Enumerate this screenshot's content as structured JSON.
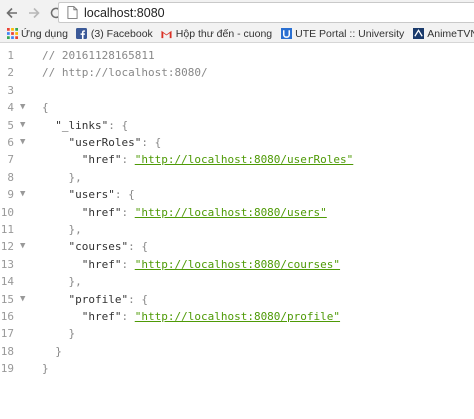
{
  "toolbar": {
    "url": "localhost:8080"
  },
  "bookmarks": [
    {
      "label": "Ứng dụng",
      "icon": "apps-grid-icon",
      "color": "#e94235"
    },
    {
      "label": "(3) Facebook",
      "icon": "facebook-icon",
      "color": "#3b5998"
    },
    {
      "label": "Hộp thư đến - cuong",
      "icon": "gmail-icon",
      "color": "#d93025"
    },
    {
      "label": "UTE Portal :: University",
      "icon": "ute-portal-icon",
      "color": "#2a6fd1"
    },
    {
      "label": "AnimeTVN - Anime V",
      "icon": "animetvn-icon",
      "color": "#1a3a6b"
    }
  ],
  "code": {
    "lines": [
      {
        "n": "1",
        "fold": "",
        "parts": [
          {
            "t": "// 20161128165811",
            "c": "comment"
          }
        ]
      },
      {
        "n": "2",
        "fold": "",
        "parts": [
          {
            "t": "// http://localhost:8080/",
            "c": "comment"
          }
        ]
      },
      {
        "n": "3",
        "fold": "",
        "parts": []
      },
      {
        "n": "4",
        "fold": "▼",
        "parts": [
          {
            "t": "{",
            "c": "punct"
          }
        ]
      },
      {
        "n": "5",
        "fold": "▼",
        "parts": [
          {
            "t": "  \"_links\"",
            "c": "key"
          },
          {
            "t": ": {",
            "c": "punct"
          }
        ]
      },
      {
        "n": "6",
        "fold": "▼",
        "parts": [
          {
            "t": "    \"userRoles\"",
            "c": "key"
          },
          {
            "t": ": {",
            "c": "punct"
          }
        ]
      },
      {
        "n": "7",
        "fold": "",
        "parts": [
          {
            "t": "      \"href\"",
            "c": "key"
          },
          {
            "t": ": ",
            "c": "punct"
          },
          {
            "t": "\"http://localhost:8080/userRoles\"",
            "c": "url"
          }
        ]
      },
      {
        "n": "8",
        "fold": "",
        "parts": [
          {
            "t": "    },",
            "c": "punct"
          }
        ]
      },
      {
        "n": "9",
        "fold": "▼",
        "parts": [
          {
            "t": "    \"users\"",
            "c": "key"
          },
          {
            "t": ": {",
            "c": "punct"
          }
        ]
      },
      {
        "n": "10",
        "fold": "",
        "parts": [
          {
            "t": "      \"href\"",
            "c": "key"
          },
          {
            "t": ": ",
            "c": "punct"
          },
          {
            "t": "\"http://localhost:8080/users\"",
            "c": "url"
          }
        ]
      },
      {
        "n": "11",
        "fold": "",
        "parts": [
          {
            "t": "    },",
            "c": "punct"
          }
        ]
      },
      {
        "n": "12",
        "fold": "▼",
        "parts": [
          {
            "t": "    \"courses\"",
            "c": "key"
          },
          {
            "t": ": {",
            "c": "punct"
          }
        ]
      },
      {
        "n": "13",
        "fold": "",
        "parts": [
          {
            "t": "      \"href\"",
            "c": "key"
          },
          {
            "t": ": ",
            "c": "punct"
          },
          {
            "t": "\"http://localhost:8080/courses\"",
            "c": "url"
          }
        ]
      },
      {
        "n": "14",
        "fold": "",
        "parts": [
          {
            "t": "    },",
            "c": "punct"
          }
        ]
      },
      {
        "n": "15",
        "fold": "▼",
        "parts": [
          {
            "t": "    \"profile\"",
            "c": "key"
          },
          {
            "t": ": {",
            "c": "punct"
          }
        ]
      },
      {
        "n": "16",
        "fold": "",
        "parts": [
          {
            "t": "      \"href\"",
            "c": "key"
          },
          {
            "t": ": ",
            "c": "punct"
          },
          {
            "t": "\"http://localhost:8080/profile\"",
            "c": "url"
          }
        ]
      },
      {
        "n": "17",
        "fold": "",
        "parts": [
          {
            "t": "    }",
            "c": "punct"
          }
        ]
      },
      {
        "n": "18",
        "fold": "",
        "parts": [
          {
            "t": "  }",
            "c": "punct"
          }
        ]
      },
      {
        "n": "19",
        "fold": "",
        "parts": [
          {
            "t": "}",
            "c": "punct"
          }
        ]
      }
    ]
  }
}
